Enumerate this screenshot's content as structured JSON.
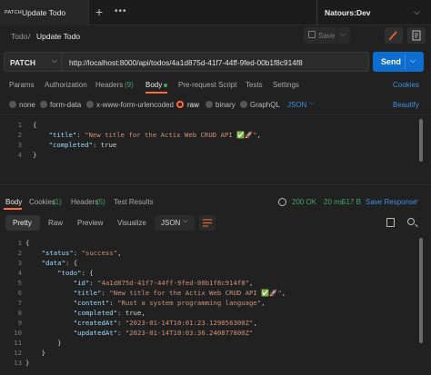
{
  "tabbar": {
    "active_tab": {
      "method": "PATCH",
      "title": "Update Todo"
    },
    "add_tab": "+",
    "more": "•••",
    "environment": "Natours:Dev"
  },
  "breadcrumb": {
    "parent": "Todo",
    "separator": "/",
    "current": "Update Todo"
  },
  "toolbar": {
    "save_label": "Save"
  },
  "request": {
    "method": "PATCH",
    "url": "http://localhost:8000/api/todos/4a1d875d-41f7-44ff-9fed-00b1f8c914f8",
    "send_label": "Send"
  },
  "request_tabs": {
    "params": "Params",
    "authorization": "Authorization",
    "headers": "Headers",
    "headers_count": "(9)",
    "body": "Body",
    "pre_request": "Pre-request Script",
    "tests": "Tests",
    "settings": "Settings",
    "cookies": "Cookies"
  },
  "body_types": {
    "none": "none",
    "form_data": "form-data",
    "urlencoded": "x-www-form-urlencoded",
    "raw": "raw",
    "binary": "binary",
    "graphql": "GraphQL",
    "format": "JSON",
    "beautify": "Beautify",
    "selected": "raw"
  },
  "request_body": {
    "line_numbers": [
      "1",
      "2",
      "3",
      "4"
    ],
    "title_key": "\"title\"",
    "title_value": "\"New title for the Actix Web CRUD API ✅🚀\"",
    "completed_key": "\"completed\"",
    "completed_value": "true"
  },
  "response_tabs": {
    "body": "Body",
    "cookies": "Cookies",
    "cookies_count": "(1)",
    "headers": "Headers",
    "headers_count": "(5)",
    "test_results": "Test Results",
    "status": "200 OK",
    "time": "20 ms",
    "size": "517 B",
    "save_response": "Save Response"
  },
  "response_view": {
    "pretty": "Pretty",
    "raw": "Raw",
    "preview": "Preview",
    "visualize": "Visualize",
    "format": "JSON"
  },
  "response_body": {
    "line_numbers": [
      "1",
      "2",
      "3",
      "4",
      "5",
      "6",
      "7",
      "8",
      "9",
      "10",
      "11",
      "12",
      "13"
    ],
    "status_key": "\"status\"",
    "status_value": "\"success\"",
    "data_key": "\"data\"",
    "todo_key": "\"todo\"",
    "id_key": "\"id\"",
    "id_value": "\"4a1d875d-41f7-44ff-9fed-00b1f8c914f8\"",
    "title_key": "\"title\"",
    "title_value": "\"New title for the Actix Web CRUD API ✅🚀\"",
    "content_key": "\"content\"",
    "content_value": "\"Rust a system programming language\"",
    "completed_key": "\"completed\"",
    "completed_value": "true",
    "created_key": "\"createdAt\"",
    "created_value": "\"2023-01-14T10:01:23.129056300Z\"",
    "updated_key": "\"updatedAt\"",
    "updated_value": "\"2023-01-14T10:03:36.240877800Z\""
  },
  "colors": {
    "accent": "#ff6c37",
    "send": "#0d6ecf",
    "success": "#3fa564",
    "link": "#3d8fe0"
  }
}
